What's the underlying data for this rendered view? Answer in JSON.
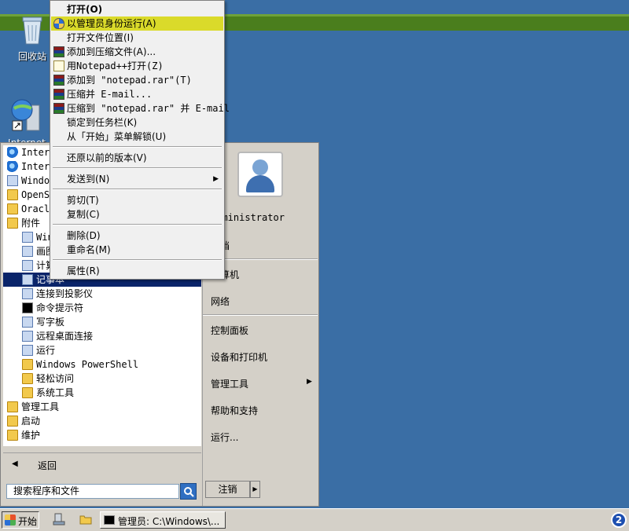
{
  "desktop": {
    "icons": [
      {
        "label": "回收站",
        "icon": "recycle-bin-icon"
      },
      {
        "label": "Internet",
        "icon": "internet-explorer-icon"
      }
    ]
  },
  "start_menu": {
    "programs": [
      {
        "label": "Internet Explorer",
        "icon": "ie-icon",
        "indent": 0
      },
      {
        "label": "Internet Explorer (64-bit)",
        "icon": "ie-icon",
        "indent": 0
      },
      {
        "label": "Windows Update",
        "icon": "windows-update-icon",
        "indent": 0
      },
      {
        "label": "OpenSSH",
        "icon": "folder-icon",
        "indent": 0
      },
      {
        "label": "Oracle",
        "icon": "folder-icon",
        "indent": 0
      },
      {
        "label": "附件",
        "icon": "folder-icon",
        "indent": 0
      },
      {
        "label": "Windows Explorer",
        "icon": "explorer-icon",
        "indent": 1
      },
      {
        "label": "画图",
        "icon": "paint-icon",
        "indent": 1
      },
      {
        "label": "计算器",
        "icon": "calculator-icon",
        "indent": 1
      },
      {
        "label": "记事本",
        "icon": "notepad-icon",
        "indent": 1,
        "selected": true
      },
      {
        "label": "连接到投影仪",
        "icon": "projector-icon",
        "indent": 1
      },
      {
        "label": "命令提示符",
        "icon": "cmd-icon",
        "indent": 1
      },
      {
        "label": "写字板",
        "icon": "wordpad-icon",
        "indent": 1
      },
      {
        "label": "远程桌面连接",
        "icon": "remote-desktop-icon",
        "indent": 1
      },
      {
        "label": "运行",
        "icon": "run-icon",
        "indent": 1
      },
      {
        "label": "Windows PowerShell",
        "icon": "folder-icon",
        "indent": 1
      },
      {
        "label": "轻松访问",
        "icon": "folder-icon",
        "indent": 1
      },
      {
        "label": "系统工具",
        "icon": "folder-icon",
        "indent": 1
      },
      {
        "label": "管理工具",
        "icon": "folder-icon",
        "indent": 0
      },
      {
        "label": "启动",
        "icon": "folder-icon",
        "indent": 0
      },
      {
        "label": "维护",
        "icon": "folder-icon",
        "indent": 0
      }
    ],
    "back_label": "返回",
    "search_placeholder": "搜索程序和文件",
    "right_pane": {
      "user": "Administrator",
      "documents": "文档",
      "computer": "计算机",
      "network": "网络",
      "control_panel": "控制面板",
      "devices_printers": "设备和打印机",
      "admin_tools": "管理工具",
      "help_support": "帮助和支持",
      "run": "运行..."
    },
    "logoff_label": "注销"
  },
  "context_menu": {
    "items": [
      {
        "label": "打开(O)",
        "bold": true,
        "icon": ""
      },
      {
        "label": "以管理员身份运行(A)",
        "icon": "uac-shield-icon",
        "highlight": true
      },
      {
        "label": "打开文件位置(I)",
        "icon": ""
      },
      {
        "label": "添加到压缩文件(A)...",
        "icon": "winrar-icon"
      },
      {
        "label": "用Notepad++打开(Z)",
        "icon": "notepad-plus-plus-icon"
      },
      {
        "label": "添加到 \"notepad.rar\"(T)",
        "icon": "winrar-icon"
      },
      {
        "label": "压缩并 E-mail...",
        "icon": "winrar-icon"
      },
      {
        "label": "压缩到 \"notepad.rar\" 并 E-mail",
        "icon": "winrar-icon"
      },
      {
        "label": "锁定到任务栏(K)",
        "icon": ""
      },
      {
        "label": "从「开始」菜单解锁(U)",
        "icon": ""
      },
      {
        "label": "还原以前的版本(V)",
        "icon": ""
      },
      {
        "label": "发送到(N)",
        "icon": "",
        "submenu": true
      },
      {
        "label": "剪切(T)",
        "icon": ""
      },
      {
        "label": "复制(C)",
        "icon": ""
      },
      {
        "label": "删除(D)",
        "icon": ""
      },
      {
        "label": "重命名(M)",
        "icon": ""
      },
      {
        "label": "属性(R)",
        "icon": ""
      }
    ]
  },
  "taskbar": {
    "start_label": "开始",
    "task_label": "管理员: C:\\Windows\\...",
    "tray_badge": "2"
  }
}
